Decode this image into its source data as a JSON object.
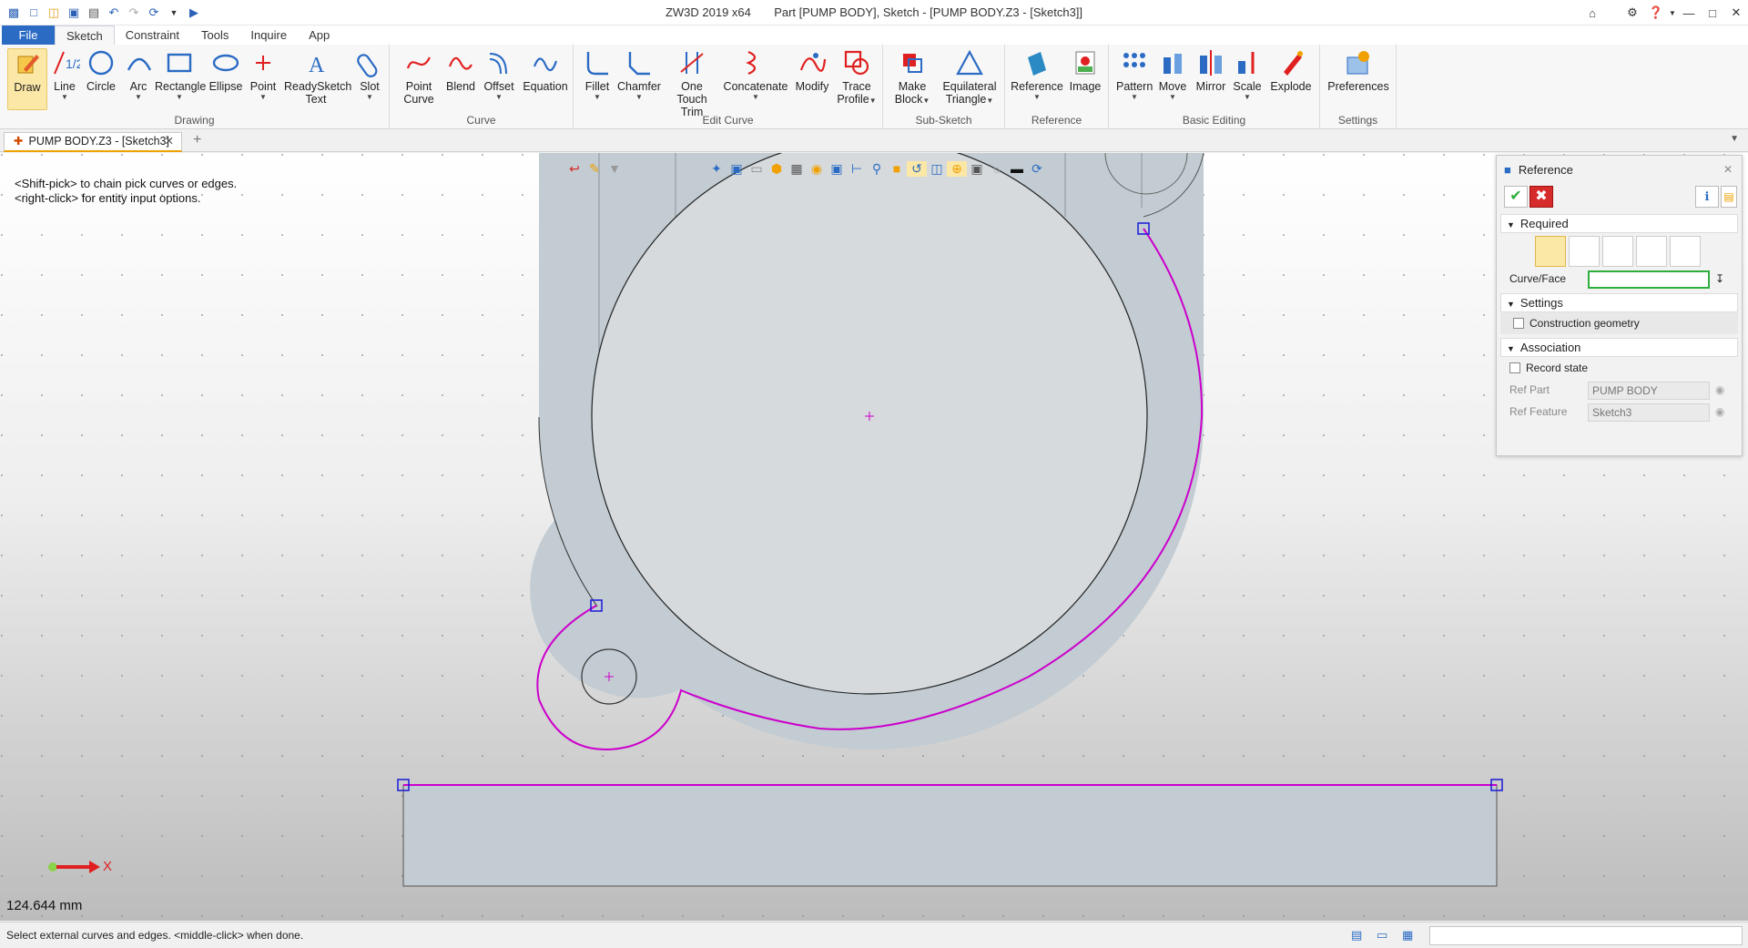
{
  "window": {
    "app": "ZW3D 2019  x64",
    "context": "Part [PUMP BODY],  Sketch - [PUMP BODY.Z3 - [Sketch3]]"
  },
  "tabs": [
    "File",
    "Sketch",
    "Constraint",
    "Tools",
    "Inquire",
    "App"
  ],
  "ribbon": {
    "drawing": {
      "label": "Drawing",
      "draw": "Draw",
      "line": "Line",
      "circle": "Circle",
      "arc": "Arc",
      "rectangle": "Rectangle",
      "ellipse": "Ellipse",
      "point": "Point",
      "readysketch_1": "ReadySketch",
      "readysketch_2": "Text",
      "slot": "Slot"
    },
    "curve": {
      "label": "Curve",
      "point_curve_1": "Point",
      "point_curve_2": "Curve",
      "blend": "Blend",
      "offset": "Offset",
      "equation": "Equation"
    },
    "edit_curve": {
      "label": "Edit Curve",
      "fillet": "Fillet",
      "chamfer": "Chamfer",
      "one_touch_1": "One Touch",
      "one_touch_2": "Trim",
      "concatenate": "Concatenate",
      "modify": "Modify",
      "trace_1": "Trace",
      "trace_2": "Profile"
    },
    "sub_sketch": {
      "label": "Sub-Sketch",
      "make_block_1": "Make",
      "make_block_2": "Block",
      "eq_tri_1": "Equilateral",
      "eq_tri_2": "Triangle"
    },
    "reference": {
      "label": "Reference",
      "reference": "Reference",
      "image": "Image"
    },
    "basic_editing": {
      "label": "Basic Editing",
      "pattern": "Pattern",
      "move": "Move",
      "mirror": "Mirror",
      "scale": "Scale",
      "explode": "Explode"
    },
    "settings": {
      "label": "Settings",
      "preferences": "Preferences"
    }
  },
  "doc_tab": {
    "label": "PUMP BODY.Z3 - [Sketch3]"
  },
  "viewport": {
    "hint_line1": "<Shift-pick> to chain pick curves or edges.",
    "hint_line2": "<right-click> for entity input options.",
    "axis_label": "X",
    "measure": "124.644 mm"
  },
  "panel": {
    "title": "Reference",
    "required": "Required",
    "curve_face_label": "Curve/Face",
    "curve_face_value": "",
    "settings": "Settings",
    "construction": "Construction geometry",
    "association": "Association",
    "record_state": "Record state",
    "ref_part_label": "Ref Part",
    "ref_part_value": "PUMP BODY",
    "ref_feature_label": "Ref Feature",
    "ref_feature_value": "Sketch3"
  },
  "status": {
    "text": "Select external curves and edges.  <middle-click> when done."
  },
  "colors": {
    "accent": "#2b6bc4",
    "highlight": "#cc00cc",
    "ok": "#2fae3e",
    "cancel": "#d62b2b"
  }
}
